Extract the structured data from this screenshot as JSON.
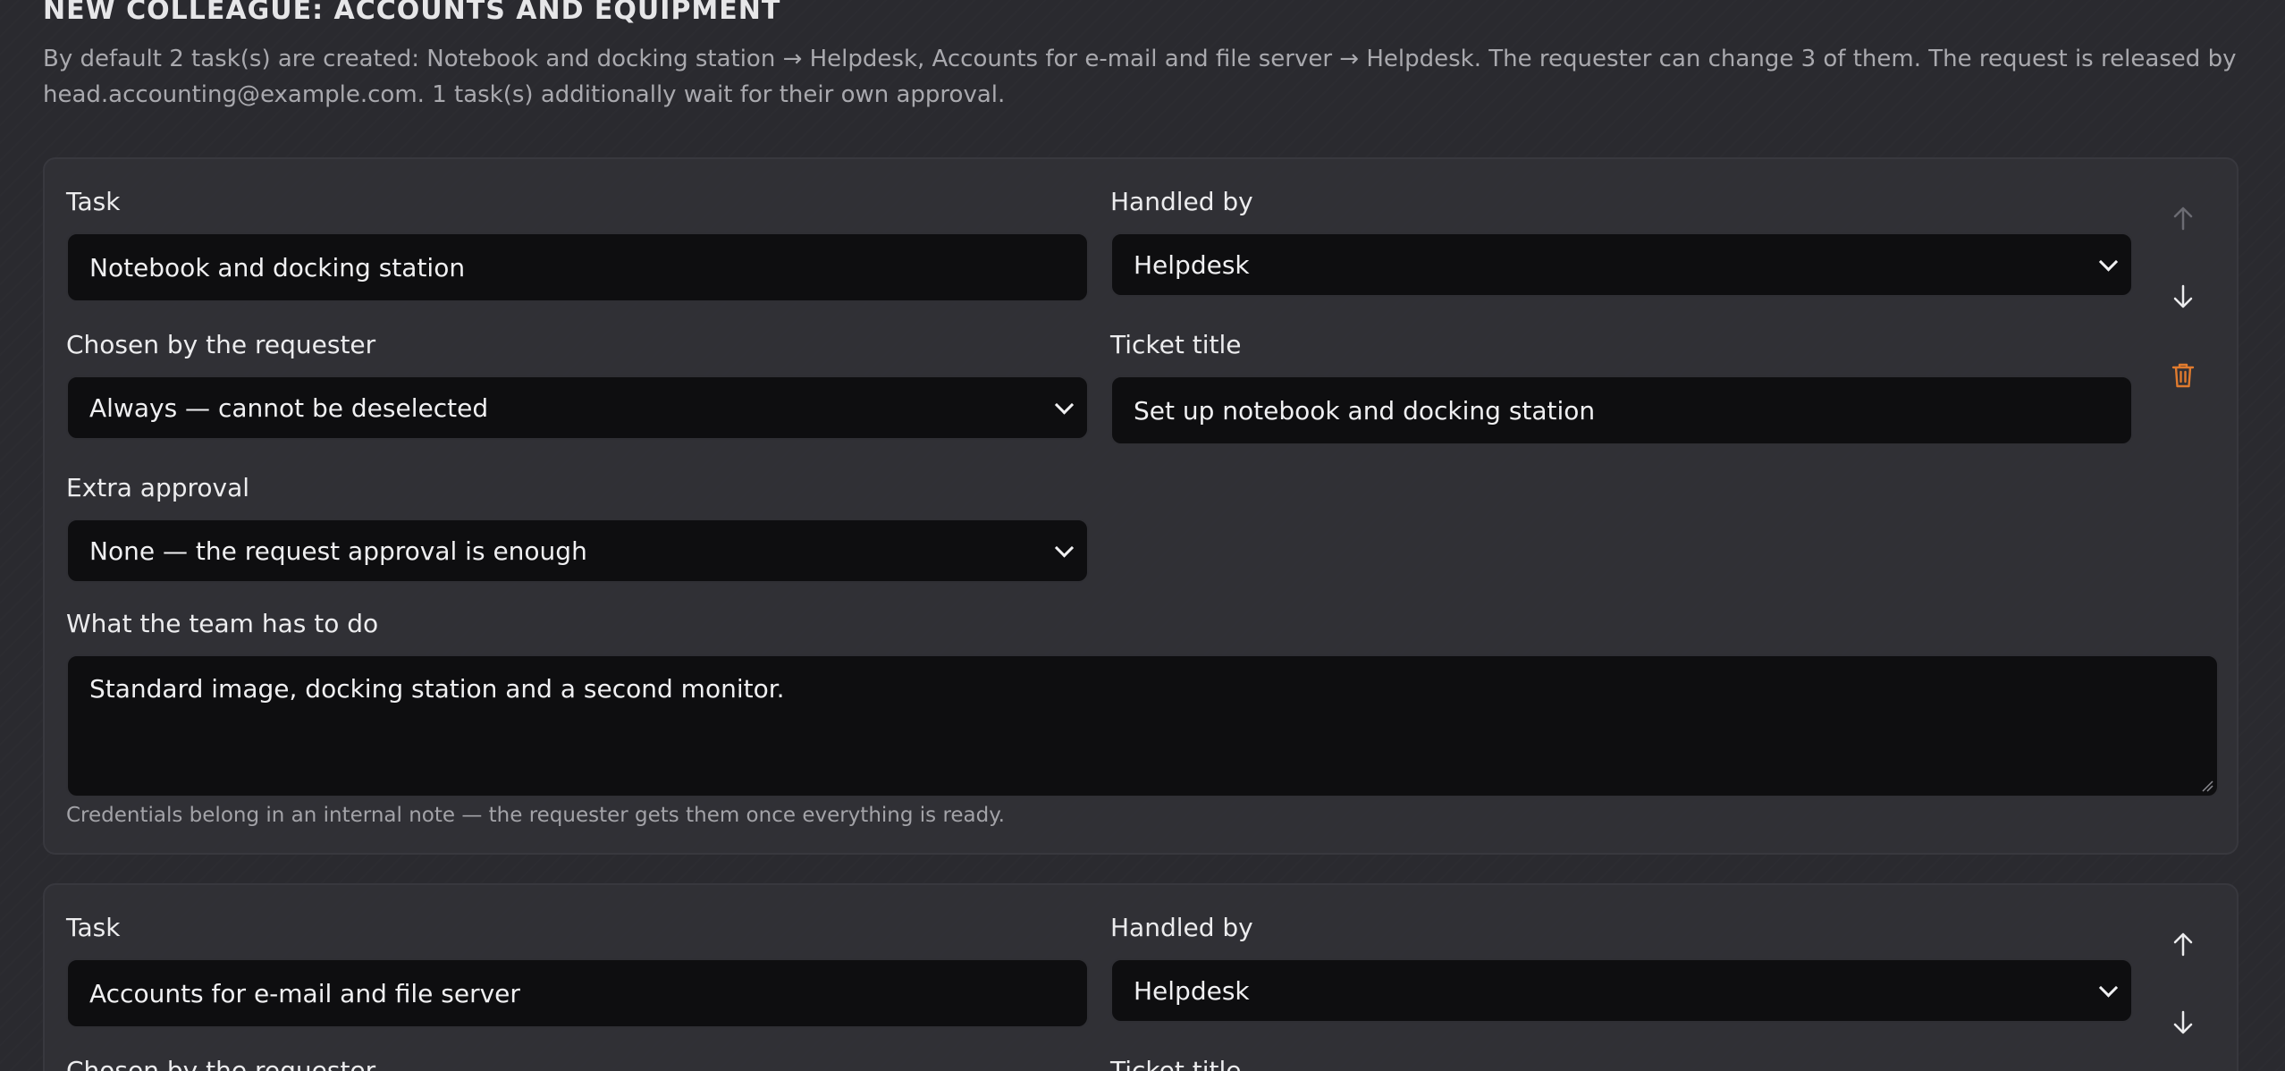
{
  "page": {
    "heading": "NEW COLLEAGUE: ACCOUNTS AND EQUIPMENT",
    "summary": "By default 2 task(s) are created: Notebook and docking station → Helpdesk, Accounts for e-mail and file server → Helpdesk. The requester can change 3 of them. The request is released by head.accounting@example.com. 1 task(s) additionally wait for their own approval."
  },
  "labels": {
    "task": "Task",
    "handled_by": "Handled by",
    "chosen_by_requester": "Chosen by the requester",
    "ticket_title": "Ticket title",
    "extra_approval": "Extra approval",
    "what_team_does": "What the team has to do",
    "hint": "Credentials belong in an internal note — the requester gets them once everything is ready."
  },
  "tasks": [
    {
      "task": "Notebook and docking station",
      "handled_by": "Helpdesk",
      "chosen_by_requester": "Always — cannot be deselected",
      "ticket_title": "Set up notebook and docking station",
      "extra_approval": "None — the request approval is enough",
      "what_team_does": "Standard image, docking station and a second monitor."
    },
    {
      "task": "Accounts for e-mail and file server",
      "handled_by": "Helpdesk"
    }
  ],
  "colors": {
    "background": "#2a2a2f",
    "field_bg": "#0e0e10",
    "delete_icon": "#e07b2e",
    "muted_text": "#a9a9ae"
  },
  "icons": {
    "move_up": "arrow-up-icon",
    "move_down": "arrow-down-icon",
    "delete": "trash-icon",
    "dropdown": "chevron-down-icon"
  }
}
